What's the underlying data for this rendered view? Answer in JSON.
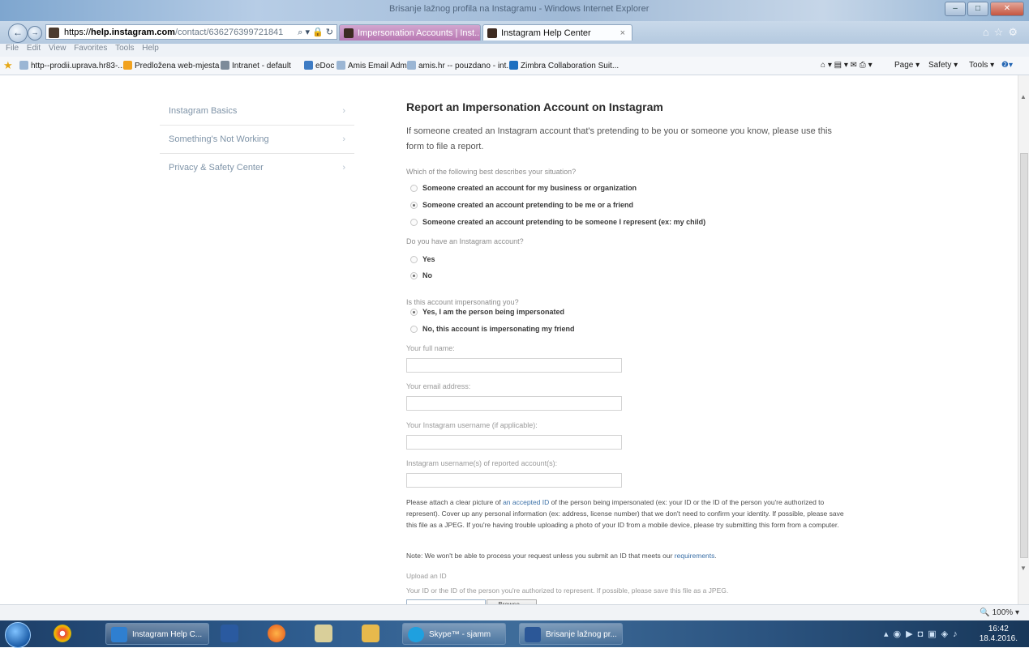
{
  "browser": {
    "window_title": "Brisanje lažnog profila na Instagramu - Windows Internet Explorer",
    "address": {
      "protocol": "https://",
      "host": "help.instagram.com",
      "path": "/contact/636276399721841",
      "controls": "⌕ ▾ 🔒 ↻"
    },
    "tabs": [
      {
        "label": "Impersonation Accounts | Inst...",
        "active": false
      },
      {
        "label": "Instagram Help Center",
        "active": true,
        "close": "×"
      }
    ],
    "menu": [
      "File",
      "Edit",
      "View",
      "Favorites",
      "Tools",
      "Help"
    ],
    "favorites": [
      "http--prodii.uprava.hr83-...",
      "Predložena web-mjesta ▾",
      "Intranet - default",
      "eDoc",
      "Amis Email Admin",
      "amis.hr -- pouzdano - int...",
      "Zimbra Collaboration Suit..."
    ],
    "command_bar": [
      "Page ▾",
      "Safety ▾",
      "Tools ▾"
    ],
    "zoom": "100%"
  },
  "sidebar": {
    "items": [
      {
        "label": "Instagram Basics"
      },
      {
        "label": "Something's Not Working"
      },
      {
        "label": "Privacy & Safety Center"
      }
    ]
  },
  "form": {
    "title": "Report an Impersonation Account on Instagram",
    "intro": "If someone created an Instagram account that's pretending to be you or someone you know, please use this form to file a report.",
    "situation": {
      "question": "Which of the following best describes your situation?",
      "options": [
        {
          "label": "Someone created an account for my business or organization",
          "selected": false
        },
        {
          "label": "Someone created an account pretending to be me or a friend",
          "selected": true
        },
        {
          "label": "Someone created an account pretending to be someone I represent (ex: my child)",
          "selected": false
        }
      ]
    },
    "has_account": {
      "question": "Do you have an Instagram account?",
      "options": [
        {
          "label": "Yes",
          "selected": false
        },
        {
          "label": "No",
          "selected": true
        }
      ]
    },
    "impersonating_you": {
      "question": "Is this account impersonating you?",
      "options": [
        {
          "label": "Yes, I am the person being impersonated",
          "selected": true
        },
        {
          "label": "No, this account is impersonating my friend",
          "selected": false
        }
      ]
    },
    "fields": [
      {
        "label": "Your full name:",
        "value": ""
      },
      {
        "label": "Your email address:",
        "value": ""
      },
      {
        "label": "Your Instagram username (if applicable):",
        "value": ""
      },
      {
        "label": "Instagram username(s) of reported account(s):",
        "value": ""
      }
    ],
    "attach": {
      "before_link": "Please attach a clear picture of ",
      "link": "an accepted ID",
      "after_link": " of the person being impersonated (ex: your ID or the ID of the person you're authorized to represent). Cover up any personal information (ex: address, license number) that we don't need to confirm your identity. If possible, please save this file as a JPEG. If you're having trouble uploading a photo of your ID from a mobile device, please try submitting this form from a computer."
    },
    "note": {
      "before_link": "Note: We won't be able to process your request unless you submit an ID that meets our ",
      "link": "requirements",
      "after_link": "."
    },
    "upload": {
      "label": "Upload an ID",
      "hint": "Your ID or the ID of the person you're authorized to represent. If possible, please save this file as a JPEG.",
      "button": "Browse..."
    }
  },
  "taskbar": {
    "tasks": [
      "Instagram Help C...",
      "Skype™ - sjamm",
      "Brisanje lažnog pr..."
    ],
    "time": "16:42",
    "date": "18.4.2016."
  }
}
